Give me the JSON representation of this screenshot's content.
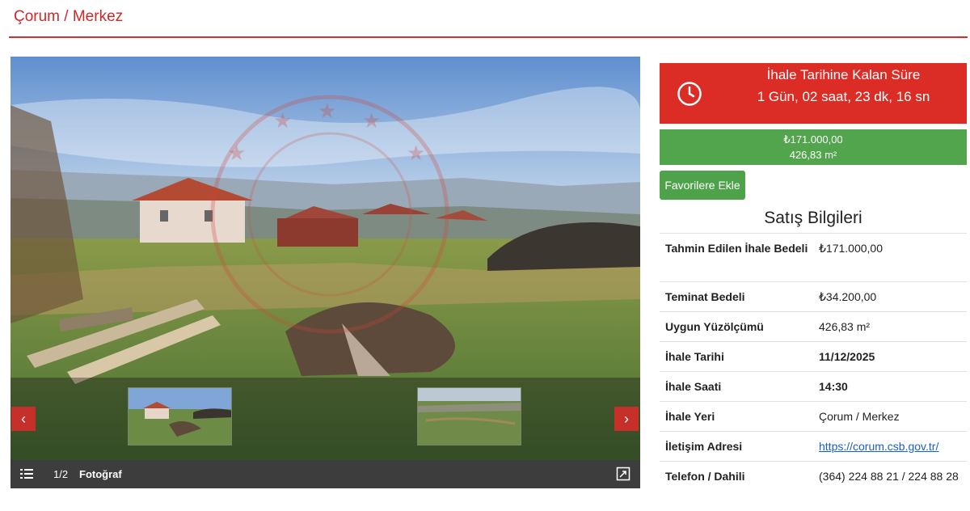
{
  "breadcrumb": "Çorum / Merkez",
  "gallery": {
    "counter": "1/2",
    "label": "Fotoğraf",
    "prev_icon": "chevron-left-icon",
    "next_icon": "chevron-right-icon",
    "list_icon": "list-icon",
    "expand_icon": "expand-icon"
  },
  "timer": {
    "title": "İhale Tarihine Kalan Süre",
    "value": "1 Gün, 02 saat, 23 dk, 16 sn",
    "icon": "clock-icon",
    "color": "#dc2c26"
  },
  "price_bar": {
    "price": "₺171.000,00",
    "area": "426,83 m²",
    "color": "#52a54d"
  },
  "favorite_button": "Favorilere Ekle",
  "sales_info": {
    "title": "Satış Bilgileri",
    "rows": [
      {
        "label": "Tahmin Edilen İhale Bedeli",
        "value": "₺171.000,00"
      },
      {
        "label": "Teminat Bedeli",
        "value": "₺34.200,00"
      },
      {
        "label": "Uygun Yüzölçümü",
        "value": "426,83 m²"
      },
      {
        "label": "İhale Tarihi",
        "value": "11/12/2025"
      },
      {
        "label": "İhale Saati",
        "value": "14:30"
      },
      {
        "label": "İhale Yeri",
        "value": "Çorum / Merkez"
      },
      {
        "label": "İletişim Adresi",
        "value": "https://corum.csb.gov.tr/"
      },
      {
        "label": "Telefon / Dahili",
        "value": "(364) 224 88 21 / 224 88 28"
      }
    ]
  }
}
